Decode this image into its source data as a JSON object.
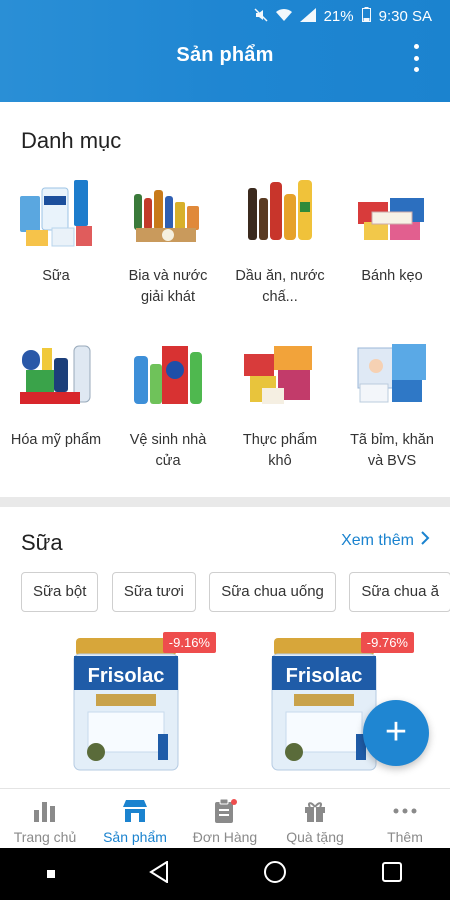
{
  "status_bar": {
    "battery": "21%",
    "time": "9:30 SA"
  },
  "header": {
    "title": "Sản phẩm"
  },
  "categories_section": {
    "title": "Danh mục",
    "items": [
      {
        "label": "Sữa",
        "icon": "milk-products-image"
      },
      {
        "label": "Bia và nước giải khát",
        "icon": "beverages-image"
      },
      {
        "label": "Dầu ăn, nước chấ...",
        "icon": "cooking-oil-image"
      },
      {
        "label": "Bánh kẹo",
        "icon": "snacks-image"
      },
      {
        "label": "Hóa mỹ phẩm",
        "icon": "cosmetics-image"
      },
      {
        "label": "Vệ sinh nhà cửa",
        "icon": "cleaning-products-image"
      },
      {
        "label": "Thực phẩm khô",
        "icon": "dry-food-image"
      },
      {
        "label": "Tã bỉm, khăn và BVS",
        "icon": "diapers-image"
      }
    ]
  },
  "milk_section": {
    "title": "Sữa",
    "see_more": "Xem thêm",
    "chips": [
      "Sữa bột",
      "Sữa tươi",
      "Sữa chua uống",
      "Sữa chua ă"
    ],
    "products": [
      {
        "brand": "Frisolac",
        "badge": "-9.16%"
      },
      {
        "brand": "Frisolac",
        "badge": "-9.76%"
      }
    ]
  },
  "bottom_nav": {
    "items": [
      {
        "label": "Trang chủ",
        "icon": "bar-chart-icon"
      },
      {
        "label": "Sản phẩm",
        "icon": "store-icon"
      },
      {
        "label": "Đơn Hàng",
        "icon": "clipboard-icon"
      },
      {
        "label": "Quà tặng",
        "icon": "gift-icon"
      },
      {
        "label": "Thêm",
        "icon": "more-dots-icon"
      }
    ]
  },
  "colors": {
    "primary": "#1f86d2",
    "badge": "#ee4d4d",
    "active_nav": "#1b83cf"
  }
}
